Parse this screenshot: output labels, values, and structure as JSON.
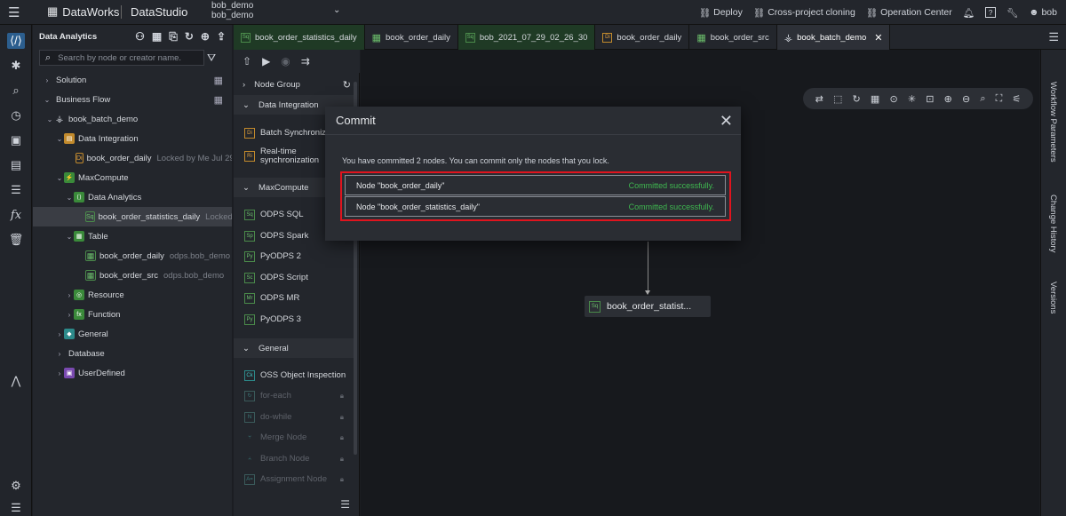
{
  "topbar": {
    "brand": "DataWorks",
    "module": "DataStudio",
    "workspace_line1": "bob_demo",
    "workspace_line2": "bob_demo",
    "deploy": "Deploy",
    "cross_project": "Cross-project cloning",
    "operation_center": "Operation Center",
    "user": "bob"
  },
  "sidebar": {
    "title": "Data Analytics",
    "search_placeholder": "Search by node or creator name.",
    "tree": [
      {
        "label": "Solution"
      },
      {
        "label": "Business Flow"
      },
      {
        "label": "book_batch_demo"
      },
      {
        "label": "Data Integration"
      },
      {
        "label": "book_order_daily",
        "meta": "Locked by Me   Jul 29"
      },
      {
        "label": "MaxCompute"
      },
      {
        "label": "Data Analytics"
      },
      {
        "label": "book_order_statistics_daily",
        "meta": "Locked"
      },
      {
        "label": "Table"
      },
      {
        "label": "book_order_daily",
        "meta": "odps.bob_demo"
      },
      {
        "label": "book_order_src",
        "meta": "odps.bob_demo"
      },
      {
        "label": "Resource"
      },
      {
        "label": "Function"
      },
      {
        "label": "General"
      },
      {
        "label": "Database"
      },
      {
        "label": "UserDefined"
      }
    ]
  },
  "tabs": [
    {
      "label": "book_order_statistics_daily",
      "icon": "Sq"
    },
    {
      "label": "book_order_daily",
      "icon": "table"
    },
    {
      "label": "bob_2021_07_29_02_26_30",
      "icon": "Sq"
    },
    {
      "label": "book_order_daily",
      "icon": "Di"
    },
    {
      "label": "book_order_src",
      "icon": "table"
    },
    {
      "label": "book_batch_demo",
      "icon": "flow"
    }
  ],
  "palette": {
    "node_group": "Node Group",
    "data_integration": "Data Integration",
    "batch_sync": "Batch Synchroniza",
    "realtime_sync_1": "Real-time",
    "realtime_sync_2": "synchronization",
    "maxcompute": "MaxCompute",
    "odps_sql": "ODPS SQL",
    "odps_spark": "ODPS Spark",
    "pyodps2": "PyODPS 2",
    "odps_script": "ODPS Script",
    "odps_mr": "ODPS MR",
    "pyodps3": "PyODPS 3",
    "general": "General",
    "oss": "OSS Object Inspection",
    "for_each": "for-each",
    "do_while": "do-while",
    "merge_node": "Merge Node",
    "branch_node": "Branch Node",
    "assignment_node": "Assignment Node"
  },
  "canvas": {
    "node_label": "book_order_statist..."
  },
  "right_panel": {
    "workflow_params": "Workflow Parameters",
    "change_history": "Change History",
    "versions": "Versions"
  },
  "modal": {
    "title": "Commit",
    "message": "You have committed 2 nodes. You can commit only the nodes that you lock.",
    "results": [
      {
        "node": "Node \"book_order_daily\"",
        "status": "Committed successfully."
      },
      {
        "node": "Node \"book_order_statistics_daily\"",
        "status": "Committed successfully."
      }
    ]
  },
  "colors": {
    "accent": "#2c5e8e",
    "success": "#3fb950",
    "highlight": "#e0141e"
  }
}
